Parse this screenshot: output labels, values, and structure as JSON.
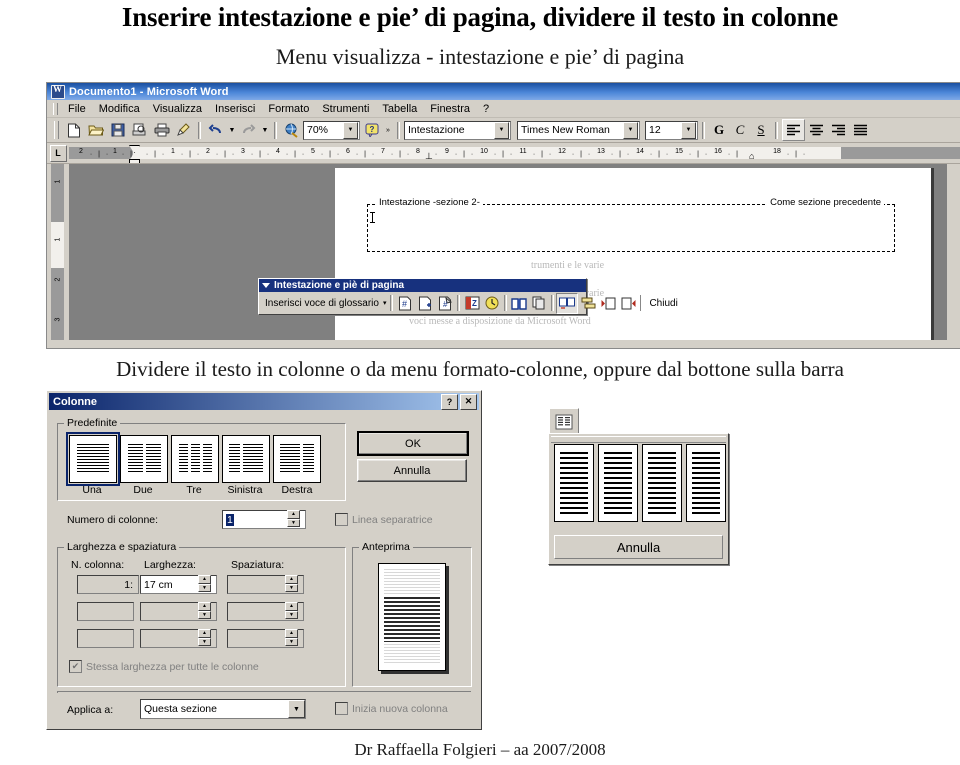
{
  "slide": {
    "title": "Inserire intestazione e pie’ di pagina, dividere il testo in colonne",
    "subtitle": "Menu visualizza - intestazione e pie’ di pagina",
    "mid_caption": "Dividere il testo in colonne o da menu formato-colonne, oppure dal bottone sulla barra",
    "footer": "Dr Raffaella Folgieri – aa 2007/2008"
  },
  "word_window": {
    "title": "Documento1 - Microsoft Word",
    "menu": [
      {
        "label": "File"
      },
      {
        "label": "Modifica"
      },
      {
        "label": "Visualizza"
      },
      {
        "label": "Inserisci"
      },
      {
        "label": "Formato"
      },
      {
        "label": "Strumenti"
      },
      {
        "label": "Tabella"
      },
      {
        "label": "Finestra"
      },
      {
        "label": "?"
      }
    ],
    "standard_toolbar": {
      "icons": [
        "new-document-icon",
        "open-folder-icon",
        "save-icon",
        "print-preview-icon",
        "print-icon",
        "format-painter-icon",
        "undo-icon",
        "redo-icon",
        "web-globe-icon"
      ],
      "zoom_value": "70%",
      "help_icon": "help-question-icon",
      "overflow_label": "»"
    },
    "formatting_toolbar": {
      "style_value": "Intestazione",
      "font_value": "Times New Roman",
      "size_value": "12",
      "bold_label": "G",
      "italic_label": "C",
      "underline_label": "S",
      "align_icons": [
        "align-left-icon",
        "align-center-icon",
        "align-right-icon",
        "align-justify-icon"
      ]
    },
    "ruler": {
      "h_ticks": [
        "2",
        "1",
        "1",
        "2",
        "3",
        "4",
        "5",
        "6",
        "7",
        "8",
        "9",
        "10",
        "11",
        "12",
        "13",
        "14",
        "15",
        "16",
        "18"
      ],
      "v_ticks": [
        "1",
        "1",
        "2",
        "3"
      ],
      "tab_selector": "L"
    },
    "document": {
      "header_label_left": "Intestazione -sezione 2-",
      "header_label_right": "Come sezione precedente",
      "ghost_text_1": "trumenti e le varie",
      "ghost_text_2": "trumenti e le varie",
      "ghost_text_3": "voci messe a disposizione da Microsoft Word"
    },
    "hf_toolbar": {
      "title": "Intestazione e piè di pagina",
      "autotext_label": "Inserisci voce di glossario",
      "autotext_arrow": "▾",
      "icons": [
        "insert-page-number-icon",
        "insert-number-of-pages-icon",
        "format-page-number-icon",
        "insert-date-icon",
        "insert-time-icon",
        "page-setup-icon",
        "show-hide-document-text-icon",
        "same-as-previous-icon",
        "switch-header-footer-icon",
        "show-previous-icon",
        "show-next-icon"
      ],
      "close_label": "Chiudi"
    }
  },
  "columns_dialog": {
    "title": "Colonne",
    "help_btn": "?",
    "close_btn": "✕",
    "presets_group": "Predefinite",
    "presets": [
      {
        "label": "Una",
        "cols": 1,
        "selected": true
      },
      {
        "label": "Due",
        "cols": 2,
        "selected": false
      },
      {
        "label": "Tre",
        "cols": 3,
        "selected": false
      },
      {
        "label": "Sinistra",
        "cols": 2,
        "selected": false
      },
      {
        "label": "Destra",
        "cols": 2,
        "selected": false
      }
    ],
    "ok_label": "OK",
    "cancel_label": "Annulla",
    "number_label": "Numero di colonne:",
    "number_value": "1",
    "separator_label": "Linea separatrice",
    "separator_checked": false,
    "width_group": "Larghezza e spaziatura",
    "col_header": "N. colonna:",
    "width_header": "Larghezza:",
    "spacing_header": "Spaziatura:",
    "rows": [
      {
        "n": "1:",
        "width": "17 cm",
        "spacing": ""
      },
      {
        "n": "",
        "width": "",
        "spacing": ""
      },
      {
        "n": "",
        "width": "",
        "spacing": ""
      }
    ],
    "equal_width_label": "Stessa larghezza per tutte le colonne",
    "equal_width_checked": true,
    "preview_group": "Anteprima",
    "apply_label": "Applica a:",
    "apply_value": "Questa sezione",
    "new_column_label": "Inizia nuova colonna",
    "new_column_checked": false
  },
  "columns_flyout": {
    "button_icon": "columns-toolbar-icon",
    "options": [
      "1 colonna",
      "2 colonne",
      "3 colonne",
      "4 colonne"
    ],
    "cancel_label": "Annulla"
  }
}
